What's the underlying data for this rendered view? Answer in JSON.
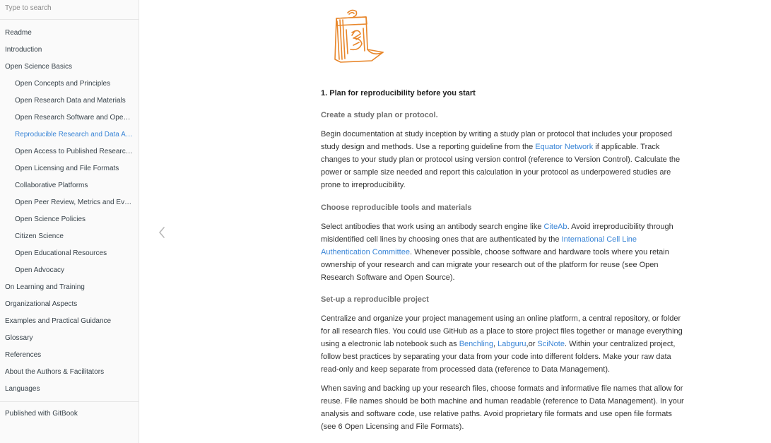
{
  "search": {
    "placeholder": "Type to search"
  },
  "sidebar": {
    "items": [
      {
        "label": "Readme",
        "level": 0,
        "active": false
      },
      {
        "label": "Introduction",
        "level": 0,
        "active": false
      },
      {
        "label": "Open Science Basics",
        "level": 0,
        "active": false
      },
      {
        "label": "Open Concepts and Principles",
        "level": 1,
        "active": false
      },
      {
        "label": "Open Research Data and Materials",
        "level": 1,
        "active": false
      },
      {
        "label": "Open Research Software and Open ...",
        "level": 1,
        "active": false
      },
      {
        "label": "Reproducible Research and Data An...",
        "level": 1,
        "active": true
      },
      {
        "label": "Open Access to Published Research...",
        "level": 1,
        "active": false
      },
      {
        "label": "Open Licensing and File Formats",
        "level": 1,
        "active": false
      },
      {
        "label": "Collaborative Platforms",
        "level": 1,
        "active": false
      },
      {
        "label": "Open Peer Review, Metrics and Eval...",
        "level": 1,
        "active": false
      },
      {
        "label": "Open Science Policies",
        "level": 1,
        "active": false
      },
      {
        "label": "Citizen Science",
        "level": 1,
        "active": false
      },
      {
        "label": "Open Educational Resources",
        "level": 1,
        "active": false
      },
      {
        "label": "Open Advocacy",
        "level": 1,
        "active": false
      },
      {
        "label": "On Learning and Training",
        "level": 0,
        "active": false
      },
      {
        "label": "Organizational Aspects",
        "level": 0,
        "active": false
      },
      {
        "label": "Examples and Practical Guidance",
        "level": 0,
        "active": false
      },
      {
        "label": "Glossary",
        "level": 0,
        "active": false
      },
      {
        "label": "References",
        "level": 0,
        "active": false
      },
      {
        "label": "About the Authors & Facilitators",
        "level": 0,
        "active": false
      },
      {
        "label": "Languages",
        "level": 0,
        "active": false
      }
    ],
    "footer": "Published with GitBook"
  },
  "colors": {
    "accent": "#3884d6",
    "illustration": "#e8862a"
  },
  "icons": {
    "prev": "chevron-left-icon",
    "illustration": "calendar-illustration-icon"
  },
  "content": {
    "heading": "1. Plan for reproducibility before you start",
    "s1": {
      "title": "Create a study plan or protocol.",
      "p1": "Begin documentation at study inception by writing a study plan or protocol that includes your proposed study design and methods. Use a reporting guideline from the ",
      "link1": "Equator Network",
      "p2": " if applicable. Track changes to your study plan or protocol using version control (reference to Version Control). Calculate the power or sample size needed and report this calculation in your protocol as underpowered studies are prone to irreproducibility."
    },
    "s2": {
      "title": "Choose reproducible tools and materials",
      "p1": "Select antibodies that work using an antibody search engine like ",
      "link1": "CiteAb",
      "p2": ". Avoid irreproducibility through misidentified cell lines by choosing ones that are authenticated by the ",
      "link2": "International Cell Line Authentication Committee",
      "p3": ". Whenever possible, choose software and hardware tools where you retain ownership of your research and can migrate your research out of the platform for reuse (see Open Research Software and Open Source)."
    },
    "s3": {
      "title": "Set-up a reproducible project",
      "p1": "Centralize and organize your project management using an online platform, a central repository, or folder for all research files. You could use GitHub as a place to store project files together or manage everything using a electronic lab notebook such as ",
      "link1": "Benchling",
      "sep1": ", ",
      "link2": "Labguru",
      "sep2": ",or ",
      "link3": "SciNote",
      "p2": ". Within your centralized project, follow best practices by separating your data from your code into different folders. Make your raw data read-only and keep separate from processed data (reference to Data Management).",
      "p3": "When saving and backing up your research files, choose formats and informative file names that allow for reuse. File names should be both machine and human readable (reference to Data Management). In your analysis and software code, use relative paths. Avoid proprietary file formats and use open file formats (see 6 Open Licensing and File Formats)."
    }
  }
}
